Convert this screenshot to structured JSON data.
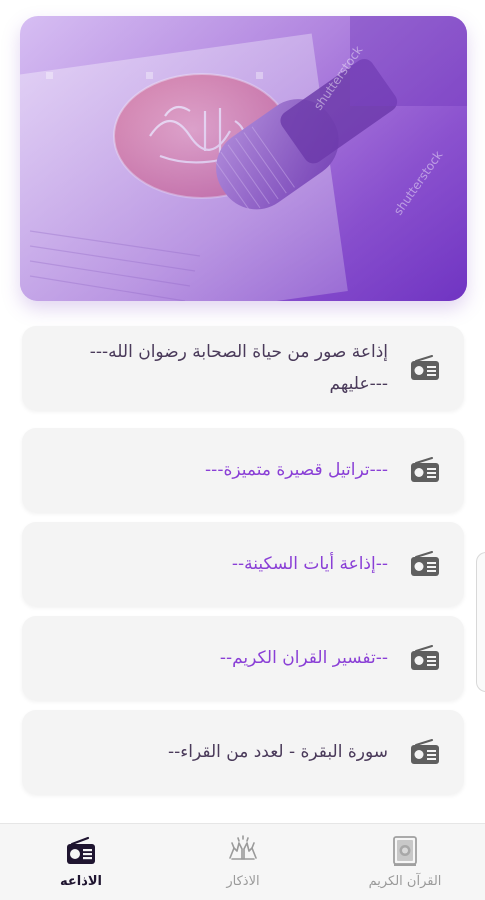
{
  "hero": {
    "image": "quran-calligraphy-and-microphone-banner",
    "calligraphy": "القرآن الكريم",
    "watermark": "shutterstock"
  },
  "stations": [
    {
      "title": "إذاعة صور من حياة الصحابة رضوان الله---\n---عليهم",
      "icon": "radio-icon",
      "style": "dark"
    },
    {
      "title": "---تراتيل قصيرة متميزة---",
      "icon": "radio-icon",
      "style": "accent"
    },
    {
      "title": "--إذاعة أيات السكينة--",
      "icon": "radio-icon",
      "style": "accent"
    },
    {
      "title": "--تفسير القران الكريم--",
      "icon": "radio-icon",
      "style": "accent"
    },
    {
      "title": "سورة البقرة - لعدد من القراء--",
      "icon": "radio-icon",
      "style": "dark"
    }
  ],
  "nav": {
    "items": [
      {
        "label": "الاذاعه",
        "icon": "radio-icon",
        "active": true
      },
      {
        "label": "الاذكار",
        "icon": "praying-hands-icon",
        "active": false
      },
      {
        "label": "القرآن الكريم",
        "icon": "quran-book-icon",
        "active": false
      }
    ]
  },
  "colors": {
    "accent": "#8a3fd6",
    "dark_text": "#4a3a5a",
    "card_bg": "#f4f4f4",
    "nav_active": "#1f1530",
    "nav_inactive": "#9a9a9a"
  }
}
